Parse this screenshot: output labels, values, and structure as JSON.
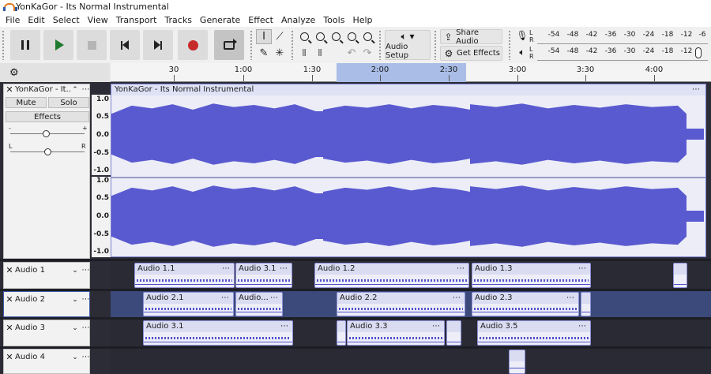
{
  "window": {
    "title": "YonKaGor - Its Normal Instrumental"
  },
  "menu": [
    "File",
    "Edit",
    "Select",
    "View",
    "Transport",
    "Tracks",
    "Generate",
    "Effect",
    "Analyze",
    "Tools",
    "Help"
  ],
  "toolbar": {
    "share_audio": "Share Audio",
    "get_effects": "Get Effects",
    "audio_setup": "Audio Setup",
    "meter_lr": "L\nR",
    "meter_ticks": [
      "-54",
      "-48",
      "-42",
      "-36",
      "-30",
      "-24",
      "-18",
      "-12",
      "-6"
    ]
  },
  "ruler": {
    "labels": [
      "30",
      "1:00",
      "1:30",
      "2:00",
      "2:30",
      "3:00",
      "3:30",
      "4:00"
    ]
  },
  "main_track": {
    "name": "YonKaGor - It...",
    "mute": "Mute",
    "solo": "Solo",
    "effects": "Effects",
    "gain_minus": "-",
    "gain_plus": "+",
    "pan_left": "L",
    "pan_right": "R",
    "clip_title": "YonKaGor - Its Normal Instrumental",
    "scale_top": [
      "1.0",
      "0.5",
      "0.0",
      "-0.5",
      "-1.0"
    ],
    "scale_bottom": [
      "1.0",
      "0.5",
      "0.0",
      "-0.5",
      "-1.0"
    ]
  },
  "audio_tracks": [
    {
      "name": "Audio 1",
      "clips": [
        "Audio 1.1",
        "Audio 3.1",
        "Audio 1.2",
        "Audio 1.3",
        ""
      ]
    },
    {
      "name": "Audio 2",
      "clips": [
        "Audio 2.1",
        "Audio...",
        "Audio 2.2",
        "Audio 2.3",
        ""
      ]
    },
    {
      "name": "Audio 3",
      "clips": [
        "Audio 3.1",
        "",
        "Audio 3.3",
        "",
        "Audio 3.5"
      ]
    },
    {
      "name": "Audio 4",
      "clips": [
        ""
      ]
    }
  ],
  "colors": {
    "waveform": "#5a5ad0",
    "selection": "#a9bde6",
    "record": "#c72a2a",
    "play": "#1f7a2e"
  }
}
